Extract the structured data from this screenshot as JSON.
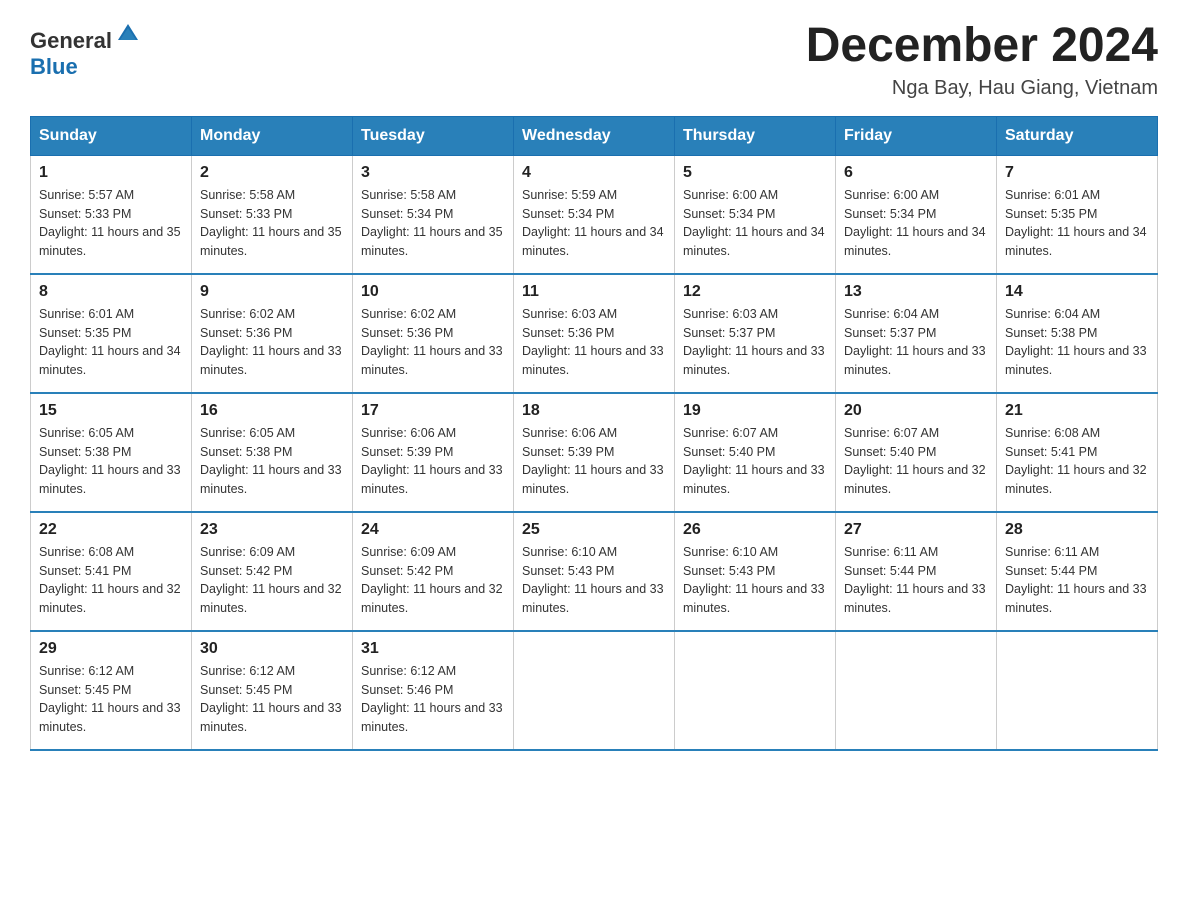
{
  "header": {
    "logo_general": "General",
    "logo_blue": "Blue",
    "month_title": "December 2024",
    "location": "Nga Bay, Hau Giang, Vietnam"
  },
  "days_of_week": [
    "Sunday",
    "Monday",
    "Tuesday",
    "Wednesday",
    "Thursday",
    "Friday",
    "Saturday"
  ],
  "weeks": [
    [
      {
        "day": "1",
        "sunrise": "5:57 AM",
        "sunset": "5:33 PM",
        "daylight": "11 hours and 35 minutes."
      },
      {
        "day": "2",
        "sunrise": "5:58 AM",
        "sunset": "5:33 PM",
        "daylight": "11 hours and 35 minutes."
      },
      {
        "day": "3",
        "sunrise": "5:58 AM",
        "sunset": "5:34 PM",
        "daylight": "11 hours and 35 minutes."
      },
      {
        "day": "4",
        "sunrise": "5:59 AM",
        "sunset": "5:34 PM",
        "daylight": "11 hours and 34 minutes."
      },
      {
        "day": "5",
        "sunrise": "6:00 AM",
        "sunset": "5:34 PM",
        "daylight": "11 hours and 34 minutes."
      },
      {
        "day": "6",
        "sunrise": "6:00 AM",
        "sunset": "5:34 PM",
        "daylight": "11 hours and 34 minutes."
      },
      {
        "day": "7",
        "sunrise": "6:01 AM",
        "sunset": "5:35 PM",
        "daylight": "11 hours and 34 minutes."
      }
    ],
    [
      {
        "day": "8",
        "sunrise": "6:01 AM",
        "sunset": "5:35 PM",
        "daylight": "11 hours and 34 minutes."
      },
      {
        "day": "9",
        "sunrise": "6:02 AM",
        "sunset": "5:36 PM",
        "daylight": "11 hours and 33 minutes."
      },
      {
        "day": "10",
        "sunrise": "6:02 AM",
        "sunset": "5:36 PM",
        "daylight": "11 hours and 33 minutes."
      },
      {
        "day": "11",
        "sunrise": "6:03 AM",
        "sunset": "5:36 PM",
        "daylight": "11 hours and 33 minutes."
      },
      {
        "day": "12",
        "sunrise": "6:03 AM",
        "sunset": "5:37 PM",
        "daylight": "11 hours and 33 minutes."
      },
      {
        "day": "13",
        "sunrise": "6:04 AM",
        "sunset": "5:37 PM",
        "daylight": "11 hours and 33 minutes."
      },
      {
        "day": "14",
        "sunrise": "6:04 AM",
        "sunset": "5:38 PM",
        "daylight": "11 hours and 33 minutes."
      }
    ],
    [
      {
        "day": "15",
        "sunrise": "6:05 AM",
        "sunset": "5:38 PM",
        "daylight": "11 hours and 33 minutes."
      },
      {
        "day": "16",
        "sunrise": "6:05 AM",
        "sunset": "5:38 PM",
        "daylight": "11 hours and 33 minutes."
      },
      {
        "day": "17",
        "sunrise": "6:06 AM",
        "sunset": "5:39 PM",
        "daylight": "11 hours and 33 minutes."
      },
      {
        "day": "18",
        "sunrise": "6:06 AM",
        "sunset": "5:39 PM",
        "daylight": "11 hours and 33 minutes."
      },
      {
        "day": "19",
        "sunrise": "6:07 AM",
        "sunset": "5:40 PM",
        "daylight": "11 hours and 33 minutes."
      },
      {
        "day": "20",
        "sunrise": "6:07 AM",
        "sunset": "5:40 PM",
        "daylight": "11 hours and 32 minutes."
      },
      {
        "day": "21",
        "sunrise": "6:08 AM",
        "sunset": "5:41 PM",
        "daylight": "11 hours and 32 minutes."
      }
    ],
    [
      {
        "day": "22",
        "sunrise": "6:08 AM",
        "sunset": "5:41 PM",
        "daylight": "11 hours and 32 minutes."
      },
      {
        "day": "23",
        "sunrise": "6:09 AM",
        "sunset": "5:42 PM",
        "daylight": "11 hours and 32 minutes."
      },
      {
        "day": "24",
        "sunrise": "6:09 AM",
        "sunset": "5:42 PM",
        "daylight": "11 hours and 32 minutes."
      },
      {
        "day": "25",
        "sunrise": "6:10 AM",
        "sunset": "5:43 PM",
        "daylight": "11 hours and 33 minutes."
      },
      {
        "day": "26",
        "sunrise": "6:10 AM",
        "sunset": "5:43 PM",
        "daylight": "11 hours and 33 minutes."
      },
      {
        "day": "27",
        "sunrise": "6:11 AM",
        "sunset": "5:44 PM",
        "daylight": "11 hours and 33 minutes."
      },
      {
        "day": "28",
        "sunrise": "6:11 AM",
        "sunset": "5:44 PM",
        "daylight": "11 hours and 33 minutes."
      }
    ],
    [
      {
        "day": "29",
        "sunrise": "6:12 AM",
        "sunset": "5:45 PM",
        "daylight": "11 hours and 33 minutes."
      },
      {
        "day": "30",
        "sunrise": "6:12 AM",
        "sunset": "5:45 PM",
        "daylight": "11 hours and 33 minutes."
      },
      {
        "day": "31",
        "sunrise": "6:12 AM",
        "sunset": "5:46 PM",
        "daylight": "11 hours and 33 minutes."
      },
      null,
      null,
      null,
      null
    ]
  ],
  "labels": {
    "sunrise_prefix": "Sunrise: ",
    "sunset_prefix": "Sunset: ",
    "daylight_prefix": "Daylight: "
  }
}
